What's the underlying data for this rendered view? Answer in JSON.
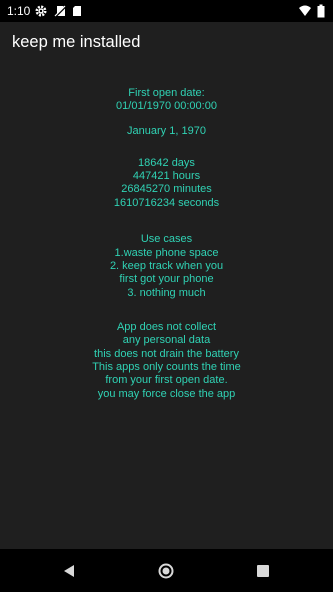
{
  "status_bar": {
    "time": "1:10",
    "icons": [
      "gear-icon",
      "no-sim-icon",
      "sd-card-icon",
      "wifi-icon",
      "battery-icon"
    ]
  },
  "app_bar": {
    "title": "keep me installed"
  },
  "content": {
    "first_open_label": "First open date:",
    "first_open_value": "01/01/1970 00:00:00",
    "long_date": "January 1, 1970",
    "days": "18642 days",
    "hours": "447421 hours",
    "minutes": "26845270 minutes",
    "seconds": "1610716234 seconds",
    "use_cases_title": "Use cases",
    "use_case_1": "1.waste phone space",
    "use_case_2a": "2. keep track when you",
    "use_case_2b": "first got your phone",
    "use_case_3": "3. nothing much",
    "privacy_1": "App does not collect",
    "privacy_2": "any personal data",
    "privacy_3": "this does not drain the battery",
    "privacy_4": "This apps only counts the time",
    "privacy_5": "from your first open date.",
    "privacy_6": "you may force close the app"
  },
  "nav_bar": {
    "icons": [
      "back-icon",
      "home-icon",
      "recents-icon"
    ]
  },
  "colors": {
    "accent_text": "#30d2b4",
    "background": "#1f1f1f",
    "bar": "#000000"
  }
}
